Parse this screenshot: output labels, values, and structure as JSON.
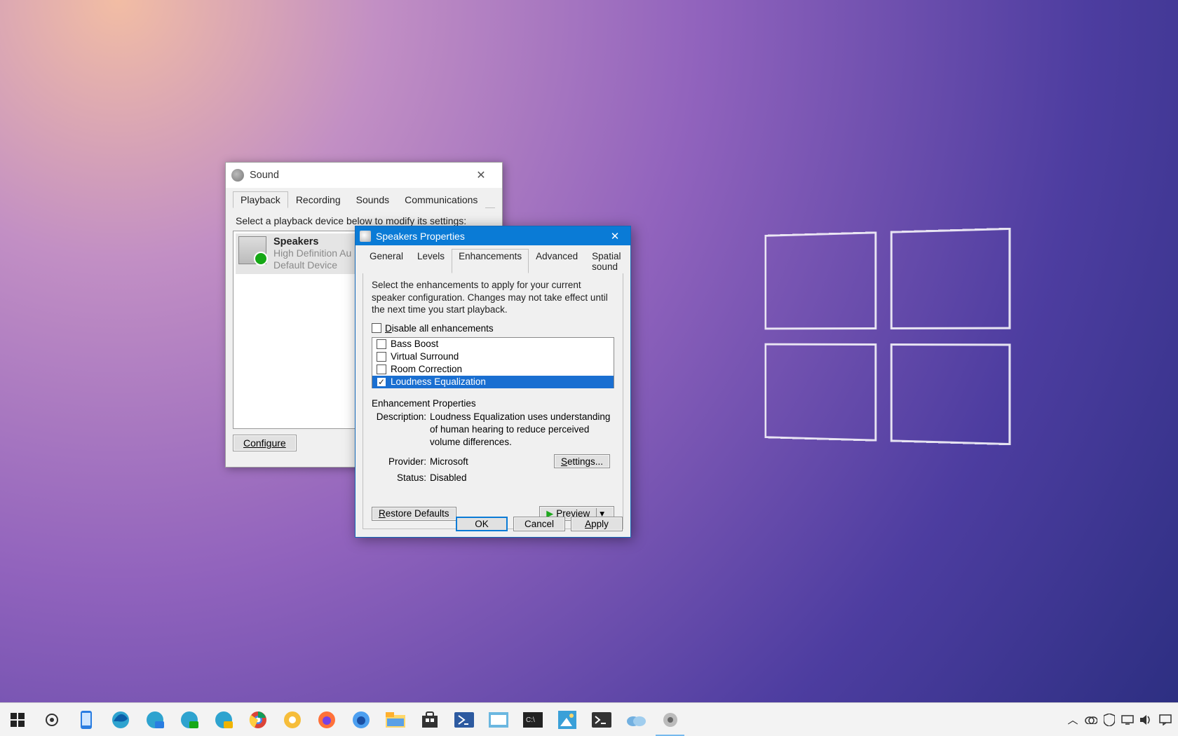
{
  "sound_window": {
    "title": "Sound",
    "tabs": [
      "Playback",
      "Recording",
      "Sounds",
      "Communications"
    ],
    "active_tab_index": 0,
    "instruction": "Select a playback device below to modify its settings:",
    "devices": [
      {
        "name": "Speakers",
        "line2": "High Definition Au",
        "line3": "Default Device"
      }
    ],
    "configure_label": "Configure"
  },
  "props_window": {
    "title": "Speakers Properties",
    "tabs": [
      "General",
      "Levels",
      "Enhancements",
      "Advanced",
      "Spatial sound"
    ],
    "active_tab_index": 2,
    "instruction": "Select the enhancements to apply for your current speaker configuration. Changes may not take effect until the next time you start playback.",
    "disable_all_checked": false,
    "disable_all_label_pre": "D",
    "disable_all_label_post": "isable all enhancements",
    "enhancements": [
      {
        "label": "Bass Boost",
        "checked": false,
        "selected": false
      },
      {
        "label": "Virtual Surround",
        "checked": false,
        "selected": false
      },
      {
        "label": "Room Correction",
        "checked": false,
        "selected": false
      },
      {
        "label": "Loudness Equalization",
        "checked": true,
        "selected": true
      }
    ],
    "properties_section_label": "Enhancement Properties",
    "description_label": "Description:",
    "description_value": "Loudness Equalization uses understanding of human hearing to reduce perceived volume differences.",
    "provider_label": "Provider:",
    "provider_value": "Microsoft",
    "status_label": "Status:",
    "status_value": "Disabled",
    "settings_btn_pre": "S",
    "settings_btn_post": "ettings...",
    "restore_btn_pre": "R",
    "restore_btn_post": "estore Defaults",
    "preview_btn_pre": "P",
    "preview_btn_post": "review",
    "ok_label": "OK",
    "cancel_label": "Cancel",
    "apply_label_pre": "A",
    "apply_label_post": "pply"
  },
  "taskbar": {
    "icons": [
      {
        "name": "start-icon"
      },
      {
        "name": "settings-icon"
      },
      {
        "name": "phone-icon"
      },
      {
        "name": "edge-icon"
      },
      {
        "name": "edge-beta-icon"
      },
      {
        "name": "edge-dev-icon"
      },
      {
        "name": "edge-canary-icon"
      },
      {
        "name": "chrome-icon"
      },
      {
        "name": "chrome-canary-icon"
      },
      {
        "name": "firefox-icon"
      },
      {
        "name": "firefox-dev-icon"
      },
      {
        "name": "file-explorer-icon"
      },
      {
        "name": "store-icon"
      },
      {
        "name": "powershell-icon"
      },
      {
        "name": "mail-icon"
      },
      {
        "name": "cmd-icon"
      },
      {
        "name": "photos-icon"
      },
      {
        "name": "terminal-icon"
      },
      {
        "name": "onedrive-icon"
      },
      {
        "name": "sound-cpl-icon",
        "active": true
      }
    ],
    "tray": [
      "chevron-up-icon",
      "onedrive-sync-icon",
      "defender-icon",
      "vm-icon",
      "volume-icon",
      "action-center-icon"
    ]
  }
}
